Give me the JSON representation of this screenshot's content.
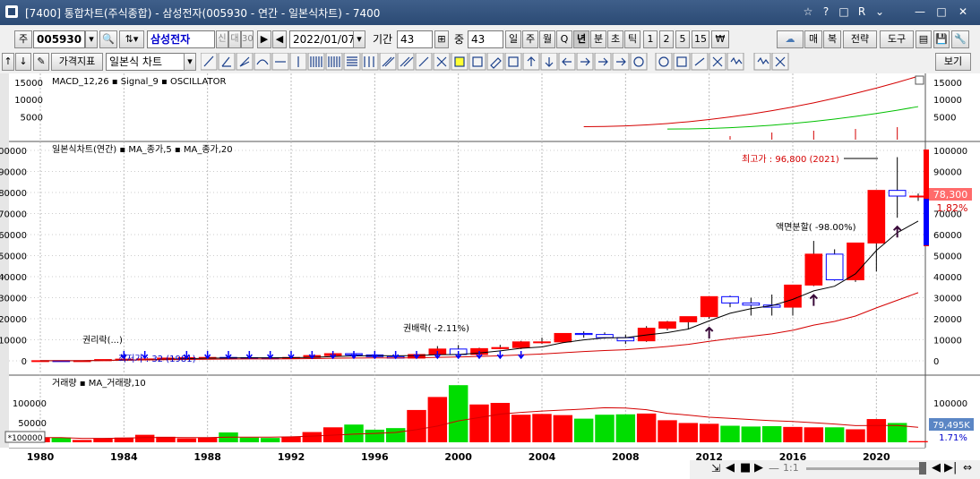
{
  "window": {
    "title": "[7400] 통합차트(주식종합) - 삼성전자(005930 - 연간 - 일본식차트) - 7400",
    "controls": [
      "☆",
      "?",
      "□",
      "R",
      "⌄",
      "—",
      "□",
      "✕"
    ]
  },
  "toolbar1": {
    "market_label": "주",
    "code": "005930",
    "name": "삼성전자",
    "name_tag1": "신",
    "name_tag2": "대",
    "name_tag3": "30",
    "date": "2022/01/07",
    "period_label": "기간",
    "period_value": "43",
    "overlap_label": "중",
    "overlap_value": "43",
    "period_buttons": [
      "일",
      "주",
      "월",
      "Q",
      "년",
      "분",
      "초",
      "틱",
      "1",
      "2",
      "5",
      "15",
      "₩"
    ],
    "right_buttons": {
      "cloud": "☁",
      "buy": "매",
      "sell": "복",
      "strategy": "전략",
      "tools": "도구",
      "more": "보기"
    }
  },
  "toolbar2": {
    "indicator_btn": "가격지표",
    "chart_type": "일본식 차트"
  },
  "panels": {
    "macd": {
      "legend": "MACD_12,26 ▪ Signal_9 ▪ OSCILLATOR",
      "ticks": [
        "15000",
        "10000",
        "5000"
      ]
    },
    "price": {
      "legend": "일본식차트(연간) ▪ MA_종가,5 ▪ MA_종가,20",
      "ticks": [
        "100000",
        "90000",
        "80000",
        "70000",
        "60000",
        "50000",
        "40000",
        "30000",
        "20000",
        "10000",
        "0"
      ],
      "high_label": "최고가 : 96,800 (2021)",
      "low_label": "최저가 : 32 (1981)",
      "split_label": "액면분할( -98.00%)",
      "right_label": "권배락( -2.11%)",
      "right_rights": "권리락(...)",
      "current_price": "78,300",
      "change_pct": "1.82%"
    },
    "volume": {
      "legend": "거래량 ▪ MA_거래량,10",
      "ticks": [
        "100000",
        "50000"
      ],
      "unit": "*100000",
      "current_value": "79,495K",
      "change_pct": "1.71%"
    }
  },
  "x_axis": {
    "labels": [
      "1980",
      "1984",
      "1988",
      "1992",
      "1996",
      "2000",
      "2004",
      "2008",
      "2012",
      "2016",
      "2020"
    ]
  },
  "colors": {
    "up": "#ff0000",
    "down": "#0000ff",
    "ma5": "#000000",
    "ma20": "#d40000",
    "vol_up": "#ff0000",
    "vol_down": "#00dd00",
    "macd": "#d40000",
    "signal": "#00c000"
  },
  "chart_data": {
    "type": "candlestick",
    "years": [
      1980,
      1981,
      1982,
      1983,
      1984,
      1985,
      1986,
      1987,
      1988,
      1989,
      1990,
      1991,
      1992,
      1993,
      1994,
      1995,
      1996,
      1997,
      1998,
      1999,
      2000,
      2001,
      2002,
      2003,
      2004,
      2005,
      2006,
      2007,
      2008,
      2009,
      2010,
      2011,
      2012,
      2013,
      2014,
      2015,
      2016,
      2017,
      2018,
      2019,
      2020,
      2021,
      2022
    ],
    "ohlc": [
      [
        60,
        80,
        40,
        60
      ],
      [
        60,
        60,
        32,
        40
      ],
      [
        40,
        60,
        35,
        50
      ],
      [
        50,
        700,
        50,
        600
      ],
      [
        600,
        900,
        500,
        800
      ],
      [
        800,
        1000,
        700,
        900
      ],
      [
        900,
        1500,
        850,
        1300
      ],
      [
        1300,
        1700,
        1200,
        1500
      ],
      [
        1500,
        1800,
        1300,
        1600
      ],
      [
        1600,
        1800,
        1400,
        1500
      ],
      [
        1500,
        1700,
        1200,
        1400
      ],
      [
        1400,
        1500,
        1100,
        1300
      ],
      [
        1300,
        1700,
        1200,
        1600
      ],
      [
        1600,
        2600,
        1500,
        2500
      ],
      [
        2500,
        3600,
        2300,
        3400
      ],
      [
        3400,
        4000,
        2500,
        2800
      ],
      [
        2800,
        3200,
        1800,
        2000
      ],
      [
        2000,
        2500,
        1100,
        1300
      ],
      [
        1300,
        3100,
        1200,
        3000
      ],
      [
        3000,
        7000,
        2900,
        5600
      ],
      [
        5600,
        7500,
        2800,
        3000
      ],
      [
        3000,
        6200,
        2600,
        5800
      ],
      [
        5800,
        7600,
        5500,
        6300
      ],
      [
        6300,
        9500,
        5600,
        9000
      ],
      [
        9000,
        11000,
        8000,
        9000
      ],
      [
        9000,
        13000,
        8500,
        13000
      ],
      [
        13000,
        14000,
        11000,
        12500
      ],
      [
        12500,
        13500,
        10500,
        11000
      ],
      [
        11000,
        12500,
        8000,
        9500
      ],
      [
        9500,
        16500,
        9000,
        15500
      ],
      [
        15500,
        19000,
        14500,
        18500
      ],
      [
        18500,
        21000,
        15000,
        21000
      ],
      [
        21000,
        30500,
        20000,
        30500
      ],
      [
        30500,
        31000,
        25500,
        27500
      ],
      [
        27500,
        30000,
        21500,
        26500
      ],
      [
        26500,
        31500,
        21500,
        25500
      ],
      [
        25500,
        36000,
        21500,
        36000
      ],
      [
        36000,
        57000,
        35500,
        50700
      ],
      [
        50700,
        53000,
        38000,
        38500
      ],
      [
        38500,
        56000,
        37500,
        56000
      ],
      [
        56000,
        81000,
        42500,
        81000
      ],
      [
        81000,
        96800,
        68000,
        78300
      ],
      [
        78300,
        79500,
        76000,
        78300
      ]
    ],
    "volume": [
      120,
      120,
      60,
      100,
      120,
      190,
      140,
      100,
      120,
      250,
      120,
      110,
      140,
      260,
      380,
      450,
      320,
      360,
      820,
      1150,
      1450,
      960,
      1000,
      700,
      720,
      690,
      600,
      700,
      710,
      730,
      560,
      490,
      470,
      420,
      400,
      410,
      390,
      380,
      380,
      330,
      590,
      490,
      30
    ],
    "ma5_end": 65000,
    "ma20_end": 32000,
    "price_ylim": [
      0,
      100000
    ],
    "volume_ylim": [
      0,
      150000
    ],
    "high": {
      "value": 96800,
      "year": 2021
    },
    "low": {
      "value": 32,
      "year": 1981
    }
  }
}
